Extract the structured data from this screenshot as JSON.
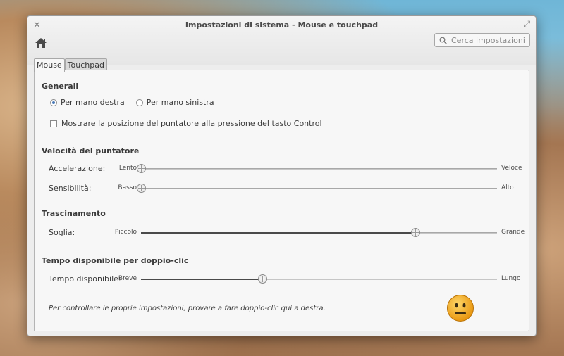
{
  "window": {
    "title": "Impostazioni di sistema - Mouse e touchpad",
    "close_glyph": "×",
    "maximize_glyph": "⤢"
  },
  "toolbar": {
    "home_icon": "home-icon",
    "search_placeholder": "Cerca impostazioni"
  },
  "tabs": [
    {
      "label": "Mouse",
      "active": true
    },
    {
      "label": "Touchpad",
      "active": false
    }
  ],
  "general": {
    "title": "Generali",
    "right_hand": "Per mano destra",
    "left_hand": "Per mano sinistra",
    "selected": "right",
    "show_pointer": "Mostrare la posizione del puntatore alla pressione del tasto Control",
    "show_pointer_checked": false
  },
  "pointer_speed": {
    "title": "Velocità del puntatore",
    "acceleration": {
      "label": "Accelerazione:",
      "min": "Lento",
      "max": "Veloce",
      "value": 0.0
    },
    "sensitivity": {
      "label": "Sensibilità:",
      "min": "Basso",
      "max": "Alto",
      "value": 0.0
    }
  },
  "drag": {
    "title": "Trascinamento",
    "threshold": {
      "label": "Soglia:",
      "min": "Piccolo",
      "max": "Grande",
      "value": 0.77
    }
  },
  "double_click": {
    "title": "Tempo disponibile per doppio-clic",
    "timeout": {
      "label": "Tempo disponibile:",
      "min": "Breve",
      "max": "Lungo",
      "value": 0.34
    },
    "hint": "Per controllare le proprie impostazioni, provare a fare doppio-clic qui a destra."
  },
  "colors": {
    "accent": "#4a7ab8",
    "smiley": "#f2a81c"
  }
}
